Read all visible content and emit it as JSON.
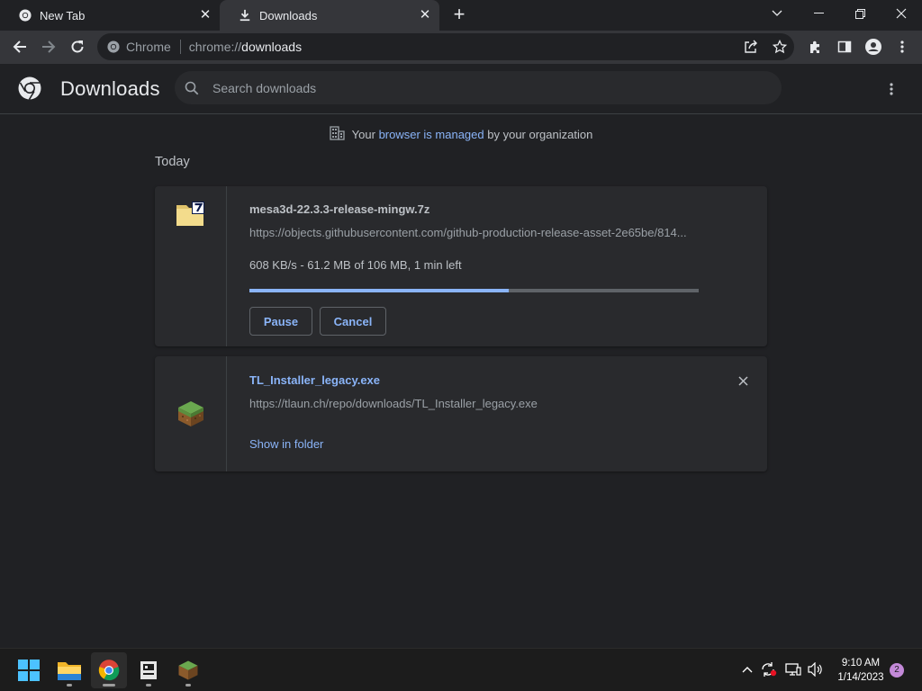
{
  "tabs": [
    {
      "title": "New Tab",
      "icon": "chrome-icon"
    },
    {
      "title": "Downloads",
      "icon": "download-icon"
    }
  ],
  "toolbar": {
    "site_label": "Chrome",
    "url_scheme": "chrome://",
    "url_host": "downloads"
  },
  "header": {
    "title": "Downloads",
    "search_placeholder": "Search downloads"
  },
  "managed": {
    "prefix": "Your",
    "link": "browser is managed",
    "suffix": "by your organization"
  },
  "section": {
    "date": "Today"
  },
  "downloads": [
    {
      "filename": "mesa3d-22.3.3-release-mingw.7z",
      "url": "https://objects.githubusercontent.com/github-production-release-asset-2e65be/814...",
      "status": "608 KB/s - 61.2 MB of 106 MB, 1 min left",
      "progress": 0.577,
      "pause_label": "Pause",
      "cancel_label": "Cancel"
    },
    {
      "filename": "TL_Installer_legacy.exe",
      "url": "https://tlaun.ch/repo/downloads/TL_Installer_legacy.exe",
      "action_label": "Show in folder"
    }
  ],
  "taskbar": {
    "time": "9:10 AM",
    "date": "1/14/2023",
    "notification_count": "2"
  },
  "colors": {
    "accent": "#8ab4f8",
    "background": "#202124",
    "card": "#292a2d"
  }
}
